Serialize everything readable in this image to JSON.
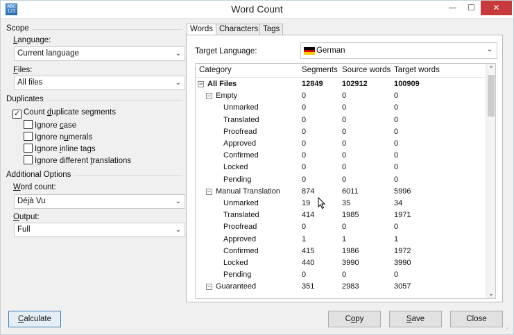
{
  "window": {
    "title": "Word Count",
    "icon_text": "ABC\n123"
  },
  "scope": {
    "section_label": "Scope",
    "language_label": "Language:",
    "language_value": "Current language",
    "files_label": "Files:",
    "files_value": "All files"
  },
  "duplicates": {
    "section_label": "Duplicates",
    "count_duplicates": {
      "label": "Count duplicate segments",
      "checked": true
    },
    "ignore_case": {
      "label": "Ignore case",
      "checked": false
    },
    "ignore_numerals": {
      "label": "Ignore numerals",
      "checked": false
    },
    "ignore_inline_tags": {
      "label": "Ignore inline tags",
      "checked": false
    },
    "ignore_different_translations": {
      "label": "Ignore different translations",
      "checked": false
    }
  },
  "additional": {
    "section_label": "Additional Options",
    "word_count_label": "Word count:",
    "word_count_value": "Déjà Vu",
    "output_label": "Output:",
    "output_value": "Full"
  },
  "tabs": [
    {
      "label": "Words",
      "active": true
    },
    {
      "label": "Characters",
      "active": false
    },
    {
      "label": "Tags",
      "active": false
    }
  ],
  "target_language": {
    "label": "Target Language:",
    "value": "German",
    "flag_colors": [
      "#000000",
      "#dd0000",
      "#ffce00"
    ]
  },
  "grid": {
    "columns": [
      "Category",
      "Segments",
      "Source words",
      "Target words"
    ],
    "rows": [
      {
        "category": "All Files",
        "level": 0,
        "expander": "−",
        "bold": true,
        "segments": "12849",
        "source": "102912",
        "target": "100909"
      },
      {
        "category": "Empty",
        "level": 1,
        "expander": "−",
        "bold": false,
        "segments": "0",
        "source": "0",
        "target": "0"
      },
      {
        "category": "Unmarked",
        "level": 2,
        "expander": "",
        "bold": false,
        "segments": "0",
        "source": "0",
        "target": "0"
      },
      {
        "category": "Translated",
        "level": 2,
        "expander": "",
        "bold": false,
        "segments": "0",
        "source": "0",
        "target": "0"
      },
      {
        "category": "Proofread",
        "level": 2,
        "expander": "",
        "bold": false,
        "segments": "0",
        "source": "0",
        "target": "0"
      },
      {
        "category": "Approved",
        "level": 2,
        "expander": "",
        "bold": false,
        "segments": "0",
        "source": "0",
        "target": "0"
      },
      {
        "category": "Confirmed",
        "level": 2,
        "expander": "",
        "bold": false,
        "segments": "0",
        "source": "0",
        "target": "0"
      },
      {
        "category": "Locked",
        "level": 2,
        "expander": "",
        "bold": false,
        "segments": "0",
        "source": "0",
        "target": "0"
      },
      {
        "category": "Pending",
        "level": 2,
        "expander": "",
        "bold": false,
        "segments": "0",
        "source": "0",
        "target": "0"
      },
      {
        "category": "Manual Translation",
        "level": 1,
        "expander": "−",
        "bold": false,
        "segments": "874",
        "source": "6011",
        "target": "5996"
      },
      {
        "category": "Unmarked",
        "level": 2,
        "expander": "",
        "bold": false,
        "segments": "19",
        "source": "35",
        "target": "34"
      },
      {
        "category": "Translated",
        "level": 2,
        "expander": "",
        "bold": false,
        "segments": "414",
        "source": "1985",
        "target": "1971"
      },
      {
        "category": "Proofread",
        "level": 2,
        "expander": "",
        "bold": false,
        "segments": "0",
        "source": "0",
        "target": "0"
      },
      {
        "category": "Approved",
        "level": 2,
        "expander": "",
        "bold": false,
        "segments": "1",
        "source": "1",
        "target": "1"
      },
      {
        "category": "Confirmed",
        "level": 2,
        "expander": "",
        "bold": false,
        "segments": "415",
        "source": "1986",
        "target": "1972"
      },
      {
        "category": "Locked",
        "level": 2,
        "expander": "",
        "bold": false,
        "segments": "440",
        "source": "3990",
        "target": "3990"
      },
      {
        "category": "Pending",
        "level": 2,
        "expander": "",
        "bold": false,
        "segments": "0",
        "source": "0",
        "target": "0"
      },
      {
        "category": "Guaranteed",
        "level": 1,
        "expander": "−",
        "bold": false,
        "segments": "351",
        "source": "2983",
        "target": "3057"
      }
    ]
  },
  "buttons": {
    "calculate": "Calculate",
    "copy": "Copy",
    "save": "Save",
    "close": "Close"
  }
}
